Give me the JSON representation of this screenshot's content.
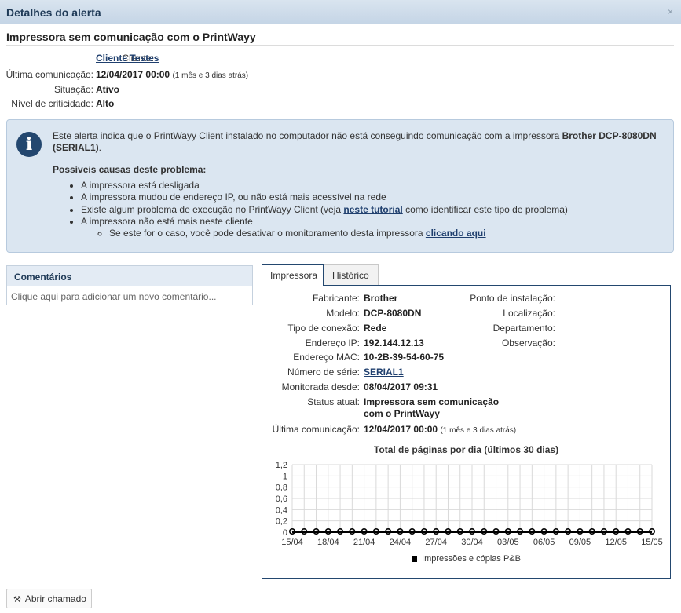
{
  "window": {
    "title": "Detalhes do alerta",
    "close_glyph": "×"
  },
  "alert": {
    "title": "Impressora sem comunicação com o PrintWayy",
    "info": {
      "cliente_label": "Cliente:",
      "cliente_value": "Cliente Testes",
      "ultima_label": "Última comunicação:",
      "ultima_value": "12/04/2017 00:00",
      "ultima_rel": "(1 mês e 3 dias atrás)",
      "situacao_label": "Situação:",
      "situacao_value": "Ativo",
      "criticidade_label": "Nível de criticidade:",
      "criticidade_value": "Alto"
    },
    "message": {
      "intro": "Este alerta indica que o PrintWayy Client instalado no computador não está conseguindo comunicação com a impressora",
      "printer": "Brother DCP-8080DN (SERIAL1)",
      "intro_end": ".",
      "causes_heading": "Possíveis causas deste problema:",
      "cause1": "A impressora está desligada",
      "cause2": "A impressora mudou de endereço IP, ou não está mais acessível na rede",
      "cause3_pre": "Existe algum problema de execução no PrintWayy Client (veja",
      "cause3_link": "neste tutorial",
      "cause3_post": "como identificar este tipo de problema)",
      "cause4": "A impressora não está mais neste cliente",
      "cause4_sub_pre": "Se este for o caso, você pode desativar o monitoramento desta impressora",
      "cause4_sub_link": "clicando aqui"
    }
  },
  "comments": {
    "header": "Comentários",
    "placeholder": "Clique aqui para adicionar um novo comentário..."
  },
  "tabs": {
    "tab1": "Impressora",
    "tab2": "Histórico"
  },
  "printer": {
    "fabricante_label": "Fabricante:",
    "fabricante": "Brother",
    "modelo_label": "Modelo:",
    "modelo": "DCP-8080DN",
    "conexao_label": "Tipo de conexão:",
    "conexao": "Rede",
    "ip_label": "Endereço IP:",
    "ip": "192.144.12.13",
    "mac_label": "Endereço MAC:",
    "mac": "10-2B-39-54-60-75",
    "serie_label": "Número de série:",
    "serie": "SERIAL1",
    "monitorada_label": "Monitorada desde:",
    "monitorada": "08/04/2017 09:31",
    "status_label": "Status atual:",
    "status_line1": "Impressora sem comunicação",
    "status_line2": "com o PrintWayy",
    "ultima_label": "Última comunicação:",
    "ultima": "12/04/2017 00:00",
    "ultima_rel": "(1 mês e 3 dias atrás)",
    "ponto_label": "Ponto de instalação:",
    "localizacao_label": "Localização:",
    "departamento_label": "Departamento:",
    "observacao_label": "Observação:"
  },
  "chart_data": {
    "type": "line",
    "title": "Total de páginas por dia (últimos 30 dias)",
    "x": [
      "15/04",
      "16/04",
      "17/04",
      "18/04",
      "19/04",
      "20/04",
      "21/04",
      "22/04",
      "23/04",
      "24/04",
      "25/04",
      "26/04",
      "27/04",
      "28/04",
      "29/04",
      "30/04",
      "01/05",
      "02/05",
      "03/05",
      "04/05",
      "05/05",
      "06/05",
      "07/05",
      "08/05",
      "09/05",
      "10/05",
      "11/05",
      "12/05",
      "13/05",
      "14/05",
      "15/05"
    ],
    "x_tick_labels": [
      "15/04",
      "18/04",
      "21/04",
      "24/04",
      "27/04",
      "30/04",
      "03/05",
      "06/05",
      "09/05",
      "12/05",
      "15/05"
    ],
    "y_ticks": [
      "0",
      "0,2",
      "0,4",
      "0,6",
      "0,8",
      "1",
      "1,2"
    ],
    "ylim": [
      0,
      1.2
    ],
    "grid": true,
    "legend_position": "bottom",
    "series": [
      {
        "name": "Impressões e cópias P&B",
        "color": "#000000",
        "values": [
          0,
          0,
          0,
          0,
          0,
          0,
          0,
          0,
          0,
          0,
          0,
          0,
          0,
          0,
          0,
          0,
          0,
          0,
          0,
          0,
          0,
          0,
          0,
          0,
          0,
          0,
          0,
          0,
          0,
          0,
          0
        ]
      }
    ]
  },
  "actions": {
    "open_ticket": "Abrir chamado"
  },
  "icons": {
    "info": "info-icon",
    "tools": "tools-icon"
  }
}
